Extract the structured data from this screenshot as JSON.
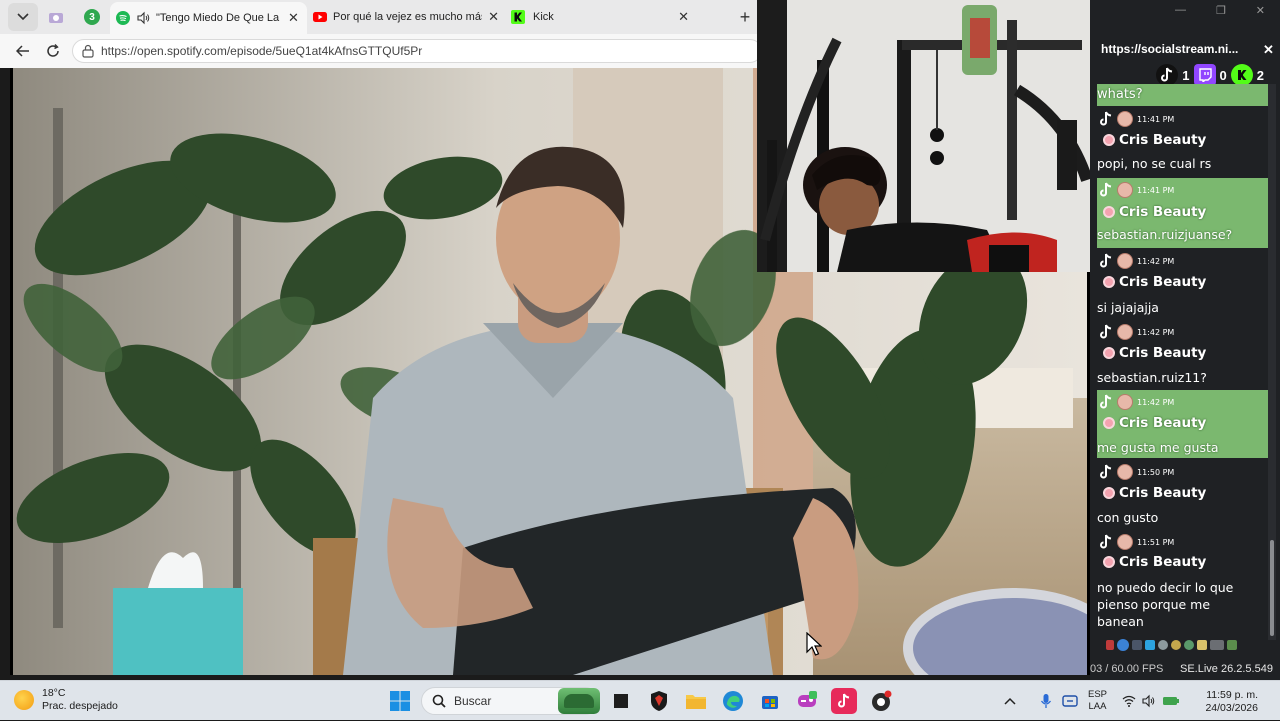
{
  "browser": {
    "tabs": [
      {
        "label": "",
        "icon": "camera-icon"
      },
      {
        "label": "3",
        "icon": "badge-icon"
      },
      {
        "label": "\"Tengo Miedo De Que La Vida",
        "icon": "spotify-icon",
        "audio_icon": "speaker-icon",
        "active": true
      },
      {
        "label": "Por qué la vejez es mucho más feliz",
        "icon": "youtube-icon"
      },
      {
        "label": "Kick",
        "icon": "kick-icon"
      }
    ],
    "new_tab_label": "+",
    "url": "https://open.spotify.com/episode/5ueQ1at4kAfnsGTTQUf5Pr"
  },
  "chat_panel": {
    "title": "https://socialstream.ni...",
    "close_label": "✕",
    "counts": [
      {
        "platform": "tiktok",
        "value": "1",
        "color": "#111111"
      },
      {
        "platform": "twitch",
        "value": "0",
        "color": "#9146ff"
      },
      {
        "platform": "kick",
        "value": "2",
        "color": "#53fc18"
      }
    ],
    "messages": [
      {
        "time": "",
        "name": "",
        "text": "whats?",
        "highlight": true,
        "partial": true
      },
      {
        "time": "11:41 PM",
        "name": "Cris Beauty",
        "text": "popi, no se cual rs",
        "highlight": false
      },
      {
        "time": "11:41 PM",
        "name": "Cris Beauty",
        "text": "sebastian.ruizjuanse?",
        "highlight": true
      },
      {
        "time": "11:42 PM",
        "name": "Cris Beauty",
        "text": "si jajajajja",
        "highlight": false
      },
      {
        "time": "11:42 PM",
        "name": "Cris Beauty",
        "text": "sebastian.ruiz11?",
        "highlight": false
      },
      {
        "time": "11:42 PM",
        "name": "Cris Beauty",
        "text": "me gusta me gusta",
        "highlight": true
      },
      {
        "time": "11:50 PM",
        "name": "Cris Beauty",
        "text": "con gusto",
        "highlight": false
      },
      {
        "time": "11:51 PM",
        "name": "Cris Beauty",
        "text": "no puedo decir lo que pienso porque me banean",
        "highlight": false
      }
    ],
    "fps": "03 / 60.00 FPS",
    "version": "SE.Live 26.2.5.549"
  },
  "taskbar": {
    "weather_temp": "18°C",
    "weather_desc": "Prac. despejado",
    "search_placeholder": "Buscar",
    "lang_top": "ESP",
    "lang_bottom": "LAA",
    "time": "11:59 p. m.",
    "date": "24/03/2026"
  },
  "colors": {
    "chat_highlight": "#7bb86f",
    "chat_bg": "#1f2124",
    "spotify": "#1db954",
    "youtube": "#ff0000",
    "kick": "#53fc18"
  }
}
